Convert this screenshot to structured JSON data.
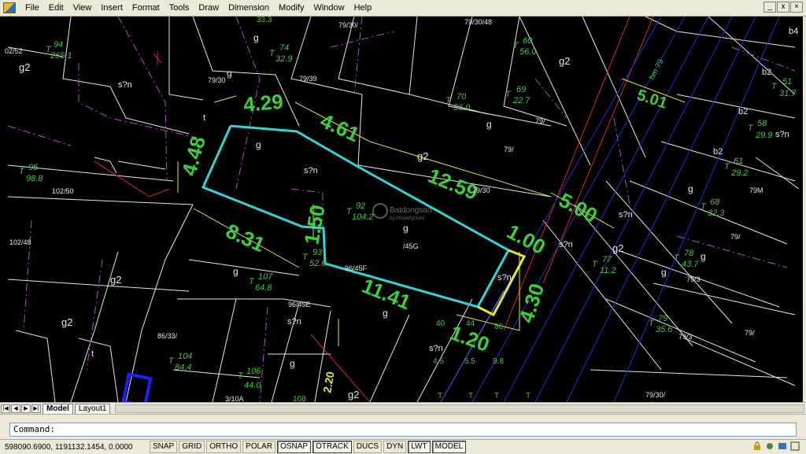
{
  "app": {
    "menus": [
      "File",
      "Edit",
      "View",
      "Insert",
      "Format",
      "Tools",
      "Draw",
      "Dimension",
      "Modify",
      "Window",
      "Help"
    ],
    "window_controls": [
      "_",
      "х",
      "×"
    ]
  },
  "drawing": {
    "colors": {
      "cyan": "#33d4d6",
      "yellow": "#e6e62a",
      "green": "#3ccf3c",
      "magenta": "#b14bc8",
      "red": "#d62828",
      "white": "#e8e8e8",
      "blue": "#2030d0",
      "bright_blue": "#1a20ff",
      "label": "#3fc93f"
    },
    "dimensions": [
      {
        "id": "4-29",
        "text": "4.29"
      },
      {
        "id": "4-48",
        "text": "4.48"
      },
      {
        "id": "4-61",
        "text": "4.61"
      },
      {
        "id": "12-59",
        "text": "12.59"
      },
      {
        "id": "5-00",
        "text": "5.00"
      },
      {
        "id": "1-00",
        "text": "1.00"
      },
      {
        "id": "1-50",
        "text": "1.50"
      },
      {
        "id": "8-31",
        "text": "8.31"
      },
      {
        "id": "11-41",
        "text": "11.41"
      },
      {
        "id": "1-20",
        "text": "1.20"
      },
      {
        "id": "4-30",
        "text": "4.30"
      },
      {
        "id": "5-01",
        "text": "5.01"
      },
      {
        "id": "2-20",
        "text": "2.20"
      }
    ],
    "parcels": [
      {
        "id": "94",
        "t": "T",
        "num": "94",
        "area": "265.1"
      },
      {
        "id": "74",
        "t": "T",
        "num": "74",
        "area": "32.9"
      },
      {
        "id": "60",
        "t": "T",
        "num": "60",
        "area": "56.0"
      },
      {
        "id": "70",
        "t": "T",
        "num": "70",
        "area": "56.0"
      },
      {
        "id": "69",
        "t": "T",
        "num": "69",
        "area": "22.7"
      },
      {
        "id": "95",
        "t": "T",
        "num": "95",
        "area": "98.8"
      },
      {
        "id": "92",
        "t": "T",
        "num": "92",
        "area": "104.2"
      },
      {
        "id": "93",
        "t": "T",
        "num": "93",
        "area": "52.6"
      },
      {
        "id": "107",
        "t": "T",
        "num": "107",
        "area": "64.8"
      },
      {
        "id": "104",
        "t": "T",
        "num": "104",
        "area": "84.4"
      },
      {
        "id": "106",
        "t": "T",
        "num": "106",
        "area": "44.0"
      },
      {
        "id": "58",
        "t": "T",
        "num": "58",
        "area": "29.9"
      },
      {
        "id": "61",
        "t": "T",
        "num": "61",
        "area": "29.2"
      },
      {
        "id": "68",
        "t": "T",
        "num": "68",
        "area": "32.3"
      },
      {
        "id": "51",
        "t": "T",
        "num": "51",
        "area": "31.7"
      },
      {
        "id": "78",
        "t": "T",
        "num": "78",
        "area": "43.7"
      },
      {
        "id": "77",
        "t": "T",
        "num": "77",
        "area": "11.2"
      },
      {
        "id": "79",
        "t": "T",
        "num": "79",
        "area": "35.6"
      }
    ],
    "labels": {
      "a1": "02/52",
      "a2": "g2",
      "a3": "g2",
      "a4": "g2",
      "a5": "g2",
      "a6": "g2",
      "a7": "g2",
      "a8": "g2",
      "a9": "s?n",
      "a10": "s?n",
      "a11": "s?n",
      "a12": "s?n",
      "a13": "s?n",
      "a14": "s?n",
      "a15": "s?n",
      "a16": "s?n",
      "a17": "g",
      "a18": "g",
      "a19": "g",
      "a20": "g",
      "a21": "g",
      "a22": "g",
      "a23": "g",
      "a24": "g",
      "a25": "g",
      "a26": "g",
      "a27": "g",
      "a28": "79/30/48",
      "a29": "79/30/",
      "a30": "79/30",
      "a31": "79/39",
      "a32": "79/",
      "a33": "79/",
      "a34": "79/30",
      "a35": "79M",
      "a36": "79/",
      "a37": "79/3",
      "a38": "79/3",
      "a39": "79/",
      "a40": "79/30/",
      "a41": "102/50",
      "a42": "102/48",
      "a43": "96/45F",
      "a44": "96/45E",
      "a45": "/45G",
      "a46": "86/33/",
      "a47": "3/10A",
      "a48": "b4",
      "a49": "b2",
      "a50": "b2",
      "a51": "b2",
      "a52": "t",
      "a53": "t",
      "a54": "hm 79",
      "a55": "40",
      "a56": "44",
      "a57": "86",
      "a58": "4.5",
      "a59": "5.5",
      "a60": "9.8",
      "a61": "T",
      "a62": "T",
      "a63": "T",
      "a64": "T",
      "a65": "108",
      "a66": "33.3"
    },
    "watermark": {
      "brand": "Batdongsan",
      "sub": "by PropertyGuru"
    }
  },
  "layout_tabs": {
    "nav": [
      "|◀",
      "◀",
      "▶",
      "▶|"
    ],
    "tabs": [
      "Model",
      "Layout1"
    ]
  },
  "command": {
    "prompt": "Command:"
  },
  "status": {
    "coords": "598090.6900, 1191132.1454, 0.0000",
    "toggles": [
      {
        "label": "SNAP",
        "on": false
      },
      {
        "label": "GRID",
        "on": false
      },
      {
        "label": "ORTHO",
        "on": false
      },
      {
        "label": "POLAR",
        "on": false
      },
      {
        "label": "OSNAP",
        "on": true
      },
      {
        "label": "OTRACK",
        "on": true
      },
      {
        "label": "DUCS",
        "on": false
      },
      {
        "label": "DYN",
        "on": false
      },
      {
        "label": "LWT",
        "on": true
      },
      {
        "label": "MODEL",
        "on": true
      }
    ]
  }
}
